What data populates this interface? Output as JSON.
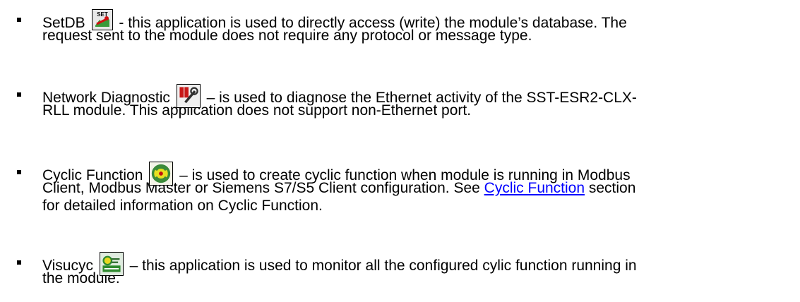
{
  "items": [
    {
      "name": "SetDB",
      "icon": "setdb-icon",
      "line1_after": " - this application is used to directly access (write) the module’s database. The",
      "line2": "request sent to the module does not require any protocol or message type."
    },
    {
      "name": "Network Diagnostic",
      "icon": "network-diagnostic-icon",
      "line1_after": " – is used to diagnose the Ethernet activity of the SST-ESR2-CLX-",
      "line2": "RLL module. This application does not support non-Ethernet port."
    },
    {
      "name": "Cyclic Function",
      "icon": "cyclic-function-icon",
      "line1_after": " – is used to create cyclic function when module is running in Modbus",
      "line2": "Client, Modbus Master or Siemens S7/S5 Client configuration. See ",
      "link": "Cyclic Function",
      "line2_after": " section",
      "line3": "for detailed information on Cyclic Function."
    },
    {
      "name": "Visucyc",
      "icon": "visucyc-icon",
      "line1_after": " – this application is used to monitor all the configured cylic function running in",
      "line2": "the module."
    }
  ],
  "icon_text": {
    "setdb": "SET"
  },
  "colors": {
    "text": "#000000",
    "link": "#0000ff"
  }
}
